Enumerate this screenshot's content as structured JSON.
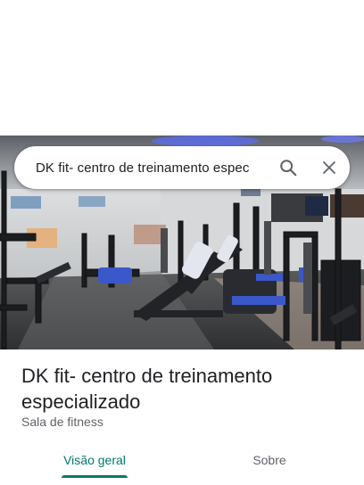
{
  "search": {
    "query": "DK fit- centro de treinamento espec",
    "search_icon": "search-icon",
    "close_icon": "close-icon"
  },
  "place": {
    "name": "DK fit- centro de treinamento especializado",
    "category": "Sala de fitness",
    "photo": "gym-interior-photo"
  },
  "tabs": [
    {
      "label": "Visão geral",
      "selected": true
    },
    {
      "label": "Sobre",
      "selected": false
    }
  ],
  "colors": {
    "accent": "#00796b",
    "text_primary": "#202124",
    "text_secondary": "#5f6368"
  }
}
